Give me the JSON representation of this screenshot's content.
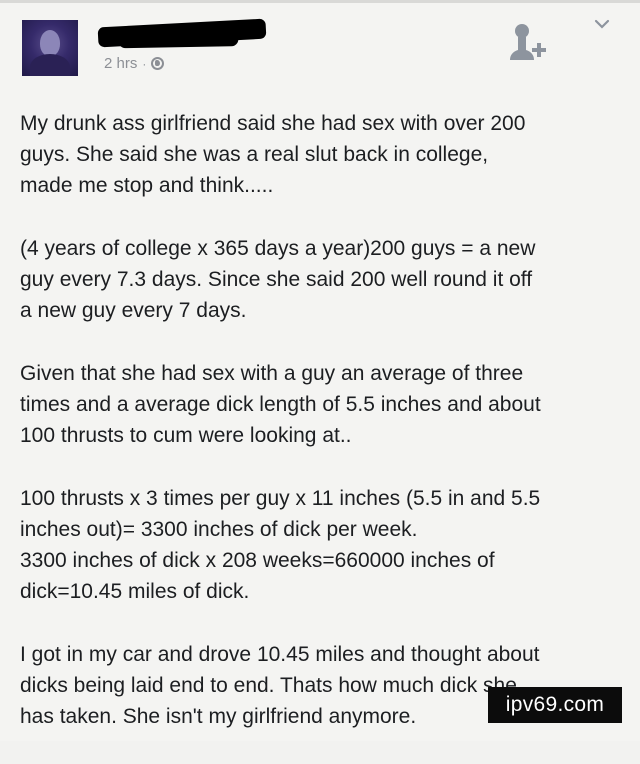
{
  "post": {
    "timestamp": "2 hrs",
    "separator": "·",
    "privacy_icon": "globe-icon",
    "author_redacted": true,
    "paragraphs": [
      "My drunk ass girlfriend said she had sex with over 200\nguys. She said she was a real slut back in college,\nmade me stop and think.....",
      "(4 years of college x 365 days a year)200 guys = a new\nguy every 7.3 days. Since she said 200 well round it off\na new guy every 7 days.",
      "Given that she had sex with a guy an average of three\ntimes and a average dick length of 5.5 inches and about\n100 thrusts to cum were looking at..",
      "100 thrusts x 3 times per guy x 11 inches (5.5 in and 5.5\ninches out)= 3300 inches of dick per week.\n3300 inches of dick x 208 weeks=660000 inches of\ndick=10.45 miles of dick.",
      "I got in my car and drove 10.45 miles and thought about\ndicks being laid end to end. Thats how much dick she\nhas taken. She isn't my girlfriend anymore."
    ]
  },
  "header": {
    "add_friend_icon": "add-friend-icon",
    "menu_icon": "chevron-down-icon"
  },
  "watermark": {
    "text": "ipv69.com"
  },
  "colors": {
    "background": "#f4f4f2",
    "text": "#1c1e21",
    "meta": "#8c8f95",
    "icon": "#8d949e"
  }
}
